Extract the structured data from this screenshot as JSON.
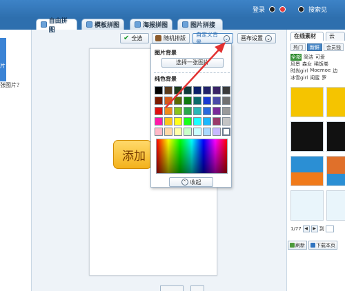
{
  "header": {
    "login_label": "登录",
    "follow_label": "搜索见"
  },
  "tabs": [
    {
      "label": "自由拼图",
      "active": true
    },
    {
      "label": "模板拼图",
      "active": false
    },
    {
      "label": "海报拼图",
      "active": false
    },
    {
      "label": "图片拼接",
      "active": false
    }
  ],
  "left": {
    "label_fragment": "片",
    "question_fragment": "张图片？"
  },
  "toolbar": {
    "select_all": "全选",
    "random_layout": "随机排版",
    "custom_background": "自定义背景",
    "canvas_settings": "画布设置"
  },
  "canvas": {
    "add_button": "添加"
  },
  "background_popup": {
    "image_bg_title": "图片背景",
    "choose_image": "选择一张图片",
    "solid_bg_title": "纯色背景",
    "collapse": "收起",
    "palette": [
      "#000000",
      "#5a3b1c",
      "#1f3b1a",
      "#0f3a3a",
      "#0a1f6a",
      "#22226a",
      "#3a2466",
      "#3a3a3a",
      "#7a1a00",
      "#d45a1a",
      "#5c6b00",
      "#0f7a0f",
      "#0a6a6a",
      "#1a3ad4",
      "#4a4aa8",
      "#707070",
      "#e01010",
      "#f08a1a",
      "#8ac41a",
      "#2aa84a",
      "#2ab8b8",
      "#2a6ae0",
      "#7a2a9a",
      "#9a9a9a",
      "#ff1aa8",
      "#ffc61a",
      "#ffff1a",
      "#1aff1a",
      "#1affff",
      "#1ab8ff",
      "#9a3a6a",
      "#c4c4c4",
      "#ffb8c8",
      "#ffd8a8",
      "#ffffa8",
      "#c8ffc8",
      "#c8ffff",
      "#a8d8ff",
      "#c8b8ff",
      "#ffffff"
    ]
  },
  "right_panel": {
    "tab_online": "在线素材",
    "tab_other": "云",
    "subtabs": [
      "热门",
      "新鲜",
      "会员独"
    ],
    "tags_row1": [
      "全部",
      "简洁",
      "可爱"
    ],
    "tags_row2": [
      "风景",
      "森女",
      "稀饭卷"
    ],
    "tags_row3": [
      "时尚girl",
      "Moemoe",
      "边"
    ],
    "tags_row4": [
      "冰雪girl",
      "闺蜜",
      "罗"
    ],
    "pager_text": "1/77",
    "pager_goto": "到",
    "refresh": "刷新",
    "download_page": "下载本页"
  }
}
